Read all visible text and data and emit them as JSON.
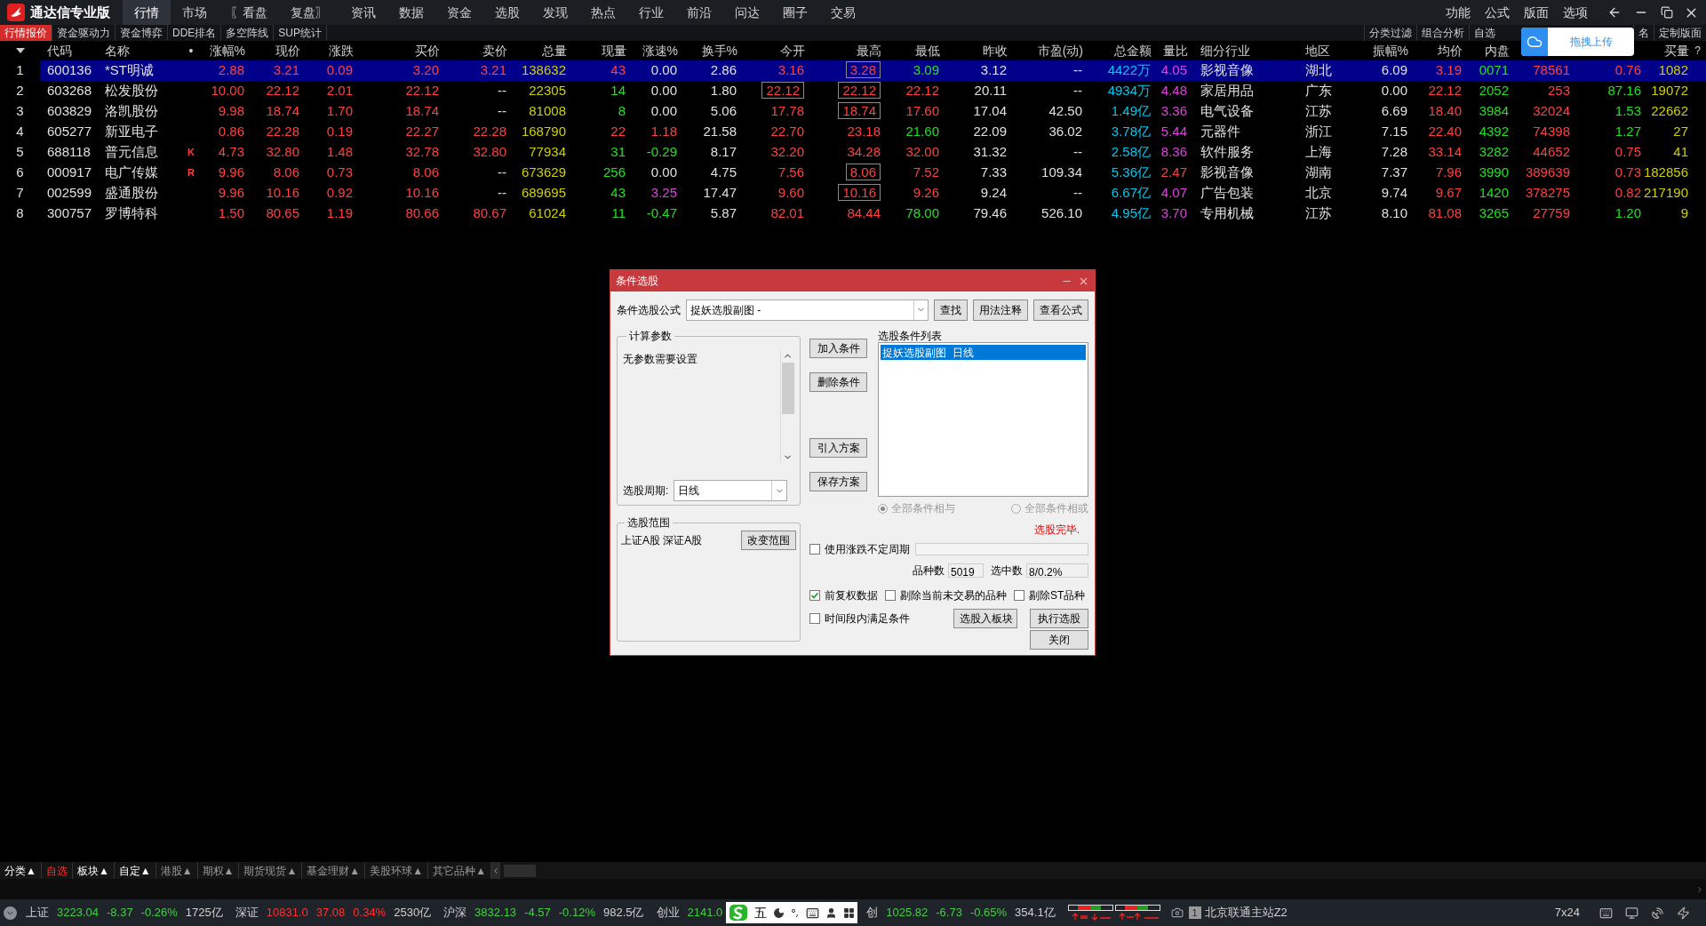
{
  "app": {
    "title": "通达信专业版"
  },
  "menu": [
    {
      "label": "行情",
      "selected": true
    },
    {
      "label": "市场",
      "selected": false
    },
    {
      "label": "〖看盘",
      "selected": false
    },
    {
      "label": "复盘〗",
      "selected": false
    },
    {
      "label": "资讯",
      "selected": false
    },
    {
      "label": "数据",
      "selected": false
    },
    {
      "label": "资金",
      "selected": false
    },
    {
      "label": "选股",
      "selected": false
    },
    {
      "label": "发现",
      "selected": false
    },
    {
      "label": "热点",
      "selected": false
    },
    {
      "label": "行业",
      "selected": false
    },
    {
      "label": "前沿",
      "selected": false
    },
    {
      "label": "问达",
      "selected": false
    },
    {
      "label": "圈子",
      "selected": false
    },
    {
      "label": "交易",
      "selected": false
    }
  ],
  "menu_right": [
    "功能",
    "公式",
    "版面",
    "选项"
  ],
  "subtabs": [
    {
      "label": "行情报价",
      "selected": true
    },
    {
      "label": "资金驱动力",
      "selected": false
    },
    {
      "label": "资金博弈",
      "selected": false
    },
    {
      "label": "DDE排名",
      "selected": false
    },
    {
      "label": "多空阵线",
      "selected": false
    },
    {
      "label": "SUP统计",
      "selected": false
    }
  ],
  "toolbar_right": [
    "分类过滤",
    "组合分析",
    "自选"
  ],
  "toolbar_far_right": [
    "名",
    "定制版面"
  ],
  "upload_popup": {
    "label": "拖拽上传"
  },
  "table": {
    "columns": [
      {
        "label": "代码",
        "kind": "text"
      },
      {
        "label": "名称",
        "kind": "text"
      },
      {
        "label": "•",
        "kind": "mark"
      },
      {
        "label": "涨幅%",
        "kind": "number"
      },
      {
        "label": "现价",
        "kind": "number"
      },
      {
        "label": "涨跌",
        "kind": "number"
      },
      {
        "label": "买价",
        "kind": "number"
      },
      {
        "label": "卖价",
        "kind": "number"
      },
      {
        "label": "总量",
        "kind": "number"
      },
      {
        "label": "现量",
        "kind": "number"
      },
      {
        "label": "涨速%",
        "kind": "number"
      },
      {
        "label": "换手%",
        "kind": "number"
      },
      {
        "label": "今开",
        "kind": "number"
      },
      {
        "label": "最高",
        "kind": "number"
      },
      {
        "label": "最低",
        "kind": "number"
      },
      {
        "label": "昨收",
        "kind": "number"
      },
      {
        "label": "市盈(动)",
        "kind": "number"
      },
      {
        "label": "总金额",
        "kind": "number"
      },
      {
        "label": "量比",
        "kind": "number"
      },
      {
        "label": "细分行业",
        "kind": "text"
      },
      {
        "label": "地区",
        "kind": "text"
      },
      {
        "label": "振幅%",
        "kind": "number"
      },
      {
        "label": "均价",
        "kind": "number"
      },
      {
        "label": "内盘",
        "kind": "number"
      },
      {
        "kind": "number"
      },
      {
        "kind": "number"
      },
      {
        "label": "买量",
        "kind": "number"
      }
    ],
    "help_mark": "?",
    "rows": [
      {
        "index": "1",
        "selected": true,
        "cells": [
          {
            "text": "600136",
            "color": "#e0e0e0"
          },
          {
            "text": "*ST明诚",
            "color": "#e0e0e0"
          },
          {
            "text": ""
          },
          {
            "text": "2.88",
            "color": "#ff4040"
          },
          {
            "text": "3.21",
            "color": "#ff4040"
          },
          {
            "text": "0.09",
            "color": "#ff4040"
          },
          {
            "text": "3.20",
            "color": "#ff4040"
          },
          {
            "text": "3.21",
            "color": "#ff4040"
          },
          {
            "text": "138632",
            "color": "#d0d000"
          },
          {
            "text": "43",
            "color": "#ff4040"
          },
          {
            "text": "0.00",
            "color": "#e0e0e0"
          },
          {
            "text": "2.86",
            "color": "#e0e0e0"
          },
          {
            "text": "3.16",
            "color": "#ff4040"
          },
          {
            "text": "3.28",
            "color": "#ff4040",
            "boxed": true
          },
          {
            "text": "3.09",
            "color": "#20e020"
          },
          {
            "text": "3.12",
            "color": "#e0e0e0"
          },
          {
            "text": "--",
            "color": "#e0e0e0"
          },
          {
            "text": "4422万",
            "color": "#00c8f0"
          },
          {
            "text": "4.05",
            "color": "#e040e0"
          },
          {
            "text": "影视音像",
            "color": "#e0e0e0"
          },
          {
            "text": "湖北",
            "color": "#e0e0e0"
          },
          {
            "text": "6.09",
            "color": "#e0e0e0"
          },
          {
            "text": "3.19",
            "color": "#ff4040"
          },
          {
            "text": "0071",
            "color": "#20e020"
          },
          {
            "text": "78561",
            "color": "#ff4040"
          },
          {
            "text": "0.76",
            "color": "#ff4040"
          },
          {
            "text": "1082",
            "color": "#d0d000"
          }
        ]
      },
      {
        "index": "2",
        "selected": false,
        "cells": [
          {
            "text": "603268",
            "color": "#e0e0e0"
          },
          {
            "text": "松发股份",
            "color": "#e0e0e0"
          },
          {
            "text": ""
          },
          {
            "text": "10.00",
            "color": "#ff4040"
          },
          {
            "text": "22.12",
            "color": "#ff4040"
          },
          {
            "text": "2.01",
            "color": "#ff4040"
          },
          {
            "text": "22.12",
            "color": "#ff4040"
          },
          {
            "text": "--",
            "color": "#e0e0e0"
          },
          {
            "text": "22305",
            "color": "#d0d000"
          },
          {
            "text": "14",
            "color": "#20e020"
          },
          {
            "text": "0.00",
            "color": "#e0e0e0"
          },
          {
            "text": "1.80",
            "color": "#e0e0e0"
          },
          {
            "text": "22.12",
            "color": "#ff4040",
            "boxed": true
          },
          {
            "text": "22.12",
            "color": "#ff4040",
            "boxed": true
          },
          {
            "text": "22.12",
            "color": "#ff4040"
          },
          {
            "text": "20.11",
            "color": "#e0e0e0"
          },
          {
            "text": "--",
            "color": "#e0e0e0"
          },
          {
            "text": "4934万",
            "color": "#00c8f0"
          },
          {
            "text": "4.48",
            "color": "#e040e0"
          },
          {
            "text": "家居用品",
            "color": "#e0e0e0"
          },
          {
            "text": "广东",
            "color": "#e0e0e0"
          },
          {
            "text": "0.00",
            "color": "#e0e0e0"
          },
          {
            "text": "22.12",
            "color": "#ff4040"
          },
          {
            "text": "2052",
            "color": "#20e020"
          },
          {
            "text": "253",
            "color": "#ff4040"
          },
          {
            "text": "87.16",
            "color": "#20e020"
          },
          {
            "text": "19072",
            "color": "#d0d000"
          }
        ]
      },
      {
        "index": "3",
        "selected": false,
        "cells": [
          {
            "text": "603829",
            "color": "#e0e0e0"
          },
          {
            "text": "洛凯股份",
            "color": "#e0e0e0"
          },
          {
            "text": ""
          },
          {
            "text": "9.98",
            "color": "#ff4040"
          },
          {
            "text": "18.74",
            "color": "#ff4040"
          },
          {
            "text": "1.70",
            "color": "#ff4040"
          },
          {
            "text": "18.74",
            "color": "#ff4040"
          },
          {
            "text": "--",
            "color": "#e0e0e0"
          },
          {
            "text": "81008",
            "color": "#d0d000"
          },
          {
            "text": "8",
            "color": "#20e020"
          },
          {
            "text": "0.00",
            "color": "#e0e0e0"
          },
          {
            "text": "5.06",
            "color": "#e0e0e0"
          },
          {
            "text": "17.78",
            "color": "#ff4040"
          },
          {
            "text": "18.74",
            "color": "#ff4040",
            "boxed": true
          },
          {
            "text": "17.60",
            "color": "#ff4040"
          },
          {
            "text": "17.04",
            "color": "#e0e0e0"
          },
          {
            "text": "42.50",
            "color": "#e0e0e0"
          },
          {
            "text": "1.49亿",
            "color": "#00c8f0"
          },
          {
            "text": "3.36",
            "color": "#e040e0"
          },
          {
            "text": "电气设备",
            "color": "#e0e0e0"
          },
          {
            "text": "江苏",
            "color": "#e0e0e0"
          },
          {
            "text": "6.69",
            "color": "#e0e0e0"
          },
          {
            "text": "18.40",
            "color": "#ff4040"
          },
          {
            "text": "3984",
            "color": "#20e020"
          },
          {
            "text": "32024",
            "color": "#ff4040"
          },
          {
            "text": "1.53",
            "color": "#20e020"
          },
          {
            "text": "22662",
            "color": "#d0d000"
          }
        ]
      },
      {
        "index": "4",
        "selected": false,
        "cells": [
          {
            "text": "605277",
            "color": "#e0e0e0"
          },
          {
            "text": "新亚电子",
            "color": "#e0e0e0"
          },
          {
            "text": ""
          },
          {
            "text": "0.86",
            "color": "#ff4040"
          },
          {
            "text": "22.28",
            "color": "#ff4040"
          },
          {
            "text": "0.19",
            "color": "#ff4040"
          },
          {
            "text": "22.27",
            "color": "#ff4040"
          },
          {
            "text": "22.28",
            "color": "#ff4040"
          },
          {
            "text": "168790",
            "color": "#d0d000"
          },
          {
            "text": "22",
            "color": "#ff4040"
          },
          {
            "text": "1.18",
            "color": "#ff4040"
          },
          {
            "text": "21.58",
            "color": "#e0e0e0"
          },
          {
            "text": "22.70",
            "color": "#ff4040"
          },
          {
            "text": "23.18",
            "color": "#ff4040"
          },
          {
            "text": "21.60",
            "color": "#20e020"
          },
          {
            "text": "22.09",
            "color": "#e0e0e0"
          },
          {
            "text": "36.02",
            "color": "#e0e0e0"
          },
          {
            "text": "3.78亿",
            "color": "#00c8f0"
          },
          {
            "text": "5.44",
            "color": "#e040e0"
          },
          {
            "text": "元器件",
            "color": "#e0e0e0"
          },
          {
            "text": "浙江",
            "color": "#e0e0e0"
          },
          {
            "text": "7.15",
            "color": "#e0e0e0"
          },
          {
            "text": "22.40",
            "color": "#ff4040"
          },
          {
            "text": "4392",
            "color": "#20e020"
          },
          {
            "text": "74398",
            "color": "#ff4040"
          },
          {
            "text": "1.27",
            "color": "#20e020"
          },
          {
            "text": "27",
            "color": "#d0d000"
          }
        ]
      },
      {
        "index": "5",
        "selected": false,
        "cells": [
          {
            "text": "688118",
            "color": "#e0e0e0"
          },
          {
            "text": "普元信息",
            "color": "#e0e0e0"
          },
          {
            "text": "K",
            "color": "#ff4040"
          },
          {
            "text": "4.73",
            "color": "#ff4040"
          },
          {
            "text": "32.80",
            "color": "#ff4040"
          },
          {
            "text": "1.48",
            "color": "#ff4040"
          },
          {
            "text": "32.78",
            "color": "#ff4040"
          },
          {
            "text": "32.80",
            "color": "#ff4040"
          },
          {
            "text": "77934",
            "color": "#d0d000"
          },
          {
            "text": "31",
            "color": "#20e020"
          },
          {
            "text": "-0.29",
            "color": "#20e020"
          },
          {
            "text": "8.17",
            "color": "#e0e0e0"
          },
          {
            "text": "32.20",
            "color": "#ff4040"
          },
          {
            "text": "34.28",
            "color": "#ff4040"
          },
          {
            "text": "32.00",
            "color": "#ff4040"
          },
          {
            "text": "31.32",
            "color": "#e0e0e0"
          },
          {
            "text": "--",
            "color": "#e0e0e0"
          },
          {
            "text": "2.58亿",
            "color": "#00c8f0"
          },
          {
            "text": "8.36",
            "color": "#e040e0"
          },
          {
            "text": "软件服务",
            "color": "#e0e0e0"
          },
          {
            "text": "上海",
            "color": "#e0e0e0"
          },
          {
            "text": "7.28",
            "color": "#e0e0e0"
          },
          {
            "text": "33.14",
            "color": "#ff4040"
          },
          {
            "text": "3282",
            "color": "#20e020"
          },
          {
            "text": "44652",
            "color": "#ff4040"
          },
          {
            "text": "0.75",
            "color": "#ff4040"
          },
          {
            "text": "41",
            "color": "#d0d000"
          }
        ]
      },
      {
        "index": "6",
        "selected": false,
        "cells": [
          {
            "text": "000917",
            "color": "#e0e0e0"
          },
          {
            "text": "电广传媒",
            "color": "#e0e0e0"
          },
          {
            "text": "R",
            "color": "#ff4040"
          },
          {
            "text": "9.96",
            "color": "#ff4040"
          },
          {
            "text": "8.06",
            "color": "#ff4040"
          },
          {
            "text": "0.73",
            "color": "#ff4040"
          },
          {
            "text": "8.06",
            "color": "#ff4040"
          },
          {
            "text": "--",
            "color": "#e0e0e0"
          },
          {
            "text": "673629",
            "color": "#d0d000"
          },
          {
            "text": "256",
            "color": "#20e020"
          },
          {
            "text": "0.00",
            "color": "#e0e0e0"
          },
          {
            "text": "4.75",
            "color": "#e0e0e0"
          },
          {
            "text": "7.56",
            "color": "#ff4040"
          },
          {
            "text": "8.06",
            "color": "#ff4040",
            "boxed": true
          },
          {
            "text": "7.52",
            "color": "#ff4040"
          },
          {
            "text": "7.33",
            "color": "#e0e0e0"
          },
          {
            "text": "109.34",
            "color": "#e0e0e0"
          },
          {
            "text": "5.36亿",
            "color": "#00c8f0"
          },
          {
            "text": "2.47",
            "color": "#ff4040"
          },
          {
            "text": "影视音像",
            "color": "#e0e0e0"
          },
          {
            "text": "湖南",
            "color": "#e0e0e0"
          },
          {
            "text": "7.37",
            "color": "#e0e0e0"
          },
          {
            "text": "7.96",
            "color": "#ff4040"
          },
          {
            "text": "3990",
            "color": "#20e020"
          },
          {
            "text": "389639",
            "color": "#ff4040"
          },
          {
            "text": "0.73",
            "color": "#ff4040"
          },
          {
            "text": "182856",
            "color": "#d0d000"
          }
        ]
      },
      {
        "index": "7",
        "selected": false,
        "cells": [
          {
            "text": "002599",
            "color": "#e0e0e0"
          },
          {
            "text": "盛通股份",
            "color": "#e0e0e0"
          },
          {
            "text": ""
          },
          {
            "text": "9.96",
            "color": "#ff4040"
          },
          {
            "text": "10.16",
            "color": "#ff4040"
          },
          {
            "text": "0.92",
            "color": "#ff4040"
          },
          {
            "text": "10.16",
            "color": "#ff4040"
          },
          {
            "text": "--",
            "color": "#e0e0e0"
          },
          {
            "text": "689695",
            "color": "#d0d000"
          },
          {
            "text": "43",
            "color": "#20e020"
          },
          {
            "text": "3.25",
            "color": "#e040e0"
          },
          {
            "text": "17.47",
            "color": "#e0e0e0"
          },
          {
            "text": "9.60",
            "color": "#ff4040"
          },
          {
            "text": "10.16",
            "color": "#ff4040",
            "boxed": true
          },
          {
            "text": "9.26",
            "color": "#ff4040"
          },
          {
            "text": "9.24",
            "color": "#e0e0e0"
          },
          {
            "text": "--",
            "color": "#e0e0e0"
          },
          {
            "text": "6.67亿",
            "color": "#00c8f0"
          },
          {
            "text": "4.07",
            "color": "#e040e0"
          },
          {
            "text": "广告包装",
            "color": "#e0e0e0"
          },
          {
            "text": "北京",
            "color": "#e0e0e0"
          },
          {
            "text": "9.74",
            "color": "#e0e0e0"
          },
          {
            "text": "9.67",
            "color": "#ff4040"
          },
          {
            "text": "1420",
            "color": "#20e020"
          },
          {
            "text": "378275",
            "color": "#ff4040"
          },
          {
            "text": "0.82",
            "color": "#ff4040"
          },
          {
            "text": "217190",
            "color": "#d0d000"
          }
        ]
      },
      {
        "index": "8",
        "selected": false,
        "cells": [
          {
            "text": "300757",
            "color": "#e0e0e0"
          },
          {
            "text": "罗博特科",
            "color": "#e0e0e0"
          },
          {
            "text": ""
          },
          {
            "text": "1.50",
            "color": "#ff4040"
          },
          {
            "text": "80.65",
            "color": "#ff4040"
          },
          {
            "text": "1.19",
            "color": "#ff4040"
          },
          {
            "text": "80.66",
            "color": "#ff4040"
          },
          {
            "text": "80.67",
            "color": "#ff4040"
          },
          {
            "text": "61024",
            "color": "#d0d000"
          },
          {
            "text": "11",
            "color": "#20e020"
          },
          {
            "text": "-0.47",
            "color": "#20e020"
          },
          {
            "text": "5.87",
            "color": "#e0e0e0"
          },
          {
            "text": "82.01",
            "color": "#ff4040"
          },
          {
            "text": "84.44",
            "color": "#ff4040"
          },
          {
            "text": "78.00",
            "color": "#20e020"
          },
          {
            "text": "79.46",
            "color": "#e0e0e0"
          },
          {
            "text": "526.10",
            "color": "#e0e0e0"
          },
          {
            "text": "4.95亿",
            "color": "#00c8f0"
          },
          {
            "text": "3.70",
            "color": "#e040e0"
          },
          {
            "text": "专用机械",
            "color": "#e0e0e0"
          },
          {
            "text": "江苏",
            "color": "#e0e0e0"
          },
          {
            "text": "8.10",
            "color": "#e0e0e0"
          },
          {
            "text": "81.08",
            "color": "#ff4040"
          },
          {
            "text": "3265",
            "color": "#20e020"
          },
          {
            "text": "27759",
            "color": "#ff4040"
          },
          {
            "text": "1.20",
            "color": "#20e020"
          },
          {
            "text": "9",
            "color": "#d0d000"
          }
        ]
      }
    ]
  },
  "dialog": {
    "title": "条件选股",
    "formula_label": "条件选股公式",
    "formula_value": "捉妖选股副图 -",
    "top_buttons": [
      "查找",
      "用法注释",
      "查看公式"
    ],
    "params_group": {
      "title": "计算参数",
      "text": "无参数需要设置",
      "period_label": "选股周期:",
      "period_value": "日线"
    },
    "side_buttons": [
      "加入条件",
      "删除条件",
      "引入方案",
      "保存方案"
    ],
    "conditions_label": "选股条件列表",
    "conditions": [
      {
        "text": "捉妖选股副图  日线",
        "selected": true
      }
    ],
    "logic": [
      {
        "label": "全部条件相与",
        "selected": true,
        "disabled": true
      },
      {
        "label": "全部条件相或",
        "selected": false,
        "disabled": true
      }
    ],
    "status": "选股完毕.",
    "range_group": {
      "title": "选股范围",
      "text": "上证A股 深证A股",
      "button": "改变范围"
    },
    "variable_period": {
      "label": "使用涨跌不定周期",
      "checked": false
    },
    "count_label": "品种数",
    "count_value": "5019",
    "selected_label": "选中数",
    "selected_value": "8/0.2%",
    "checkboxes": [
      {
        "label": "前复权数据",
        "checked": true
      },
      {
        "label": "剔除当前未交易的品种",
        "checked": false
      },
      {
        "label": "剔除ST品种",
        "checked": false
      }
    ],
    "time_condition": {
      "label": "时间段内满足条件",
      "checked": false
    },
    "action_buttons": [
      "选股入板块",
      "执行选股"
    ],
    "close_button": "关闭"
  },
  "bottom_tabs": [
    {
      "label": "分类▲",
      "selected": false,
      "dimmed": false
    },
    {
      "label": "自选",
      "selected": true,
      "dimmed": false
    },
    {
      "label": "板块▲",
      "selected": false,
      "dimmed": false
    },
    {
      "label": "自定▲",
      "selected": false,
      "dimmed": false
    },
    {
      "label": "港股▲",
      "selected": false,
      "dimmed": true
    },
    {
      "label": "期权▲",
      "selected": false,
      "dimmed": true
    },
    {
      "label": "期货现货▲",
      "selected": false,
      "dimmed": true
    },
    {
      "label": "基金理财▲",
      "selected": false,
      "dimmed": true
    },
    {
      "label": "美股环球▲",
      "selected": false,
      "dimmed": true
    },
    {
      "label": "其它品种▲",
      "selected": false,
      "dimmed": true
    }
  ],
  "quotes": [
    {
      "name": "上证",
      "value": "3223.04",
      "change": "-8.37",
      "percent": "-0.26%",
      "amount": "1725亿",
      "color": "#40d040"
    },
    {
      "name": "深证",
      "value": "10831.0",
      "change": "37.08",
      "percent": "0.34%",
      "amount": "2530亿",
      "color": "#ff3030"
    },
    {
      "name": "沪深",
      "value": "3832.13",
      "change": "-4.57",
      "percent": "-0.12%",
      "amount": "982.5亿",
      "color": "#40d040"
    },
    {
      "name": "创业",
      "value": "2141.0",
      "color": "#40d040"
    }
  ],
  "ime": {
    "mode": "五"
  },
  "quotes_after": [
    {
      "name": "创",
      "value": "1025.82",
      "change": "-6.73",
      "percent": "-0.65%",
      "amount": "354.1亿",
      "color": "#40d040"
    }
  ],
  "server": {
    "badge": "1",
    "name": "北京联通主站Z2"
  },
  "service": "7x24"
}
